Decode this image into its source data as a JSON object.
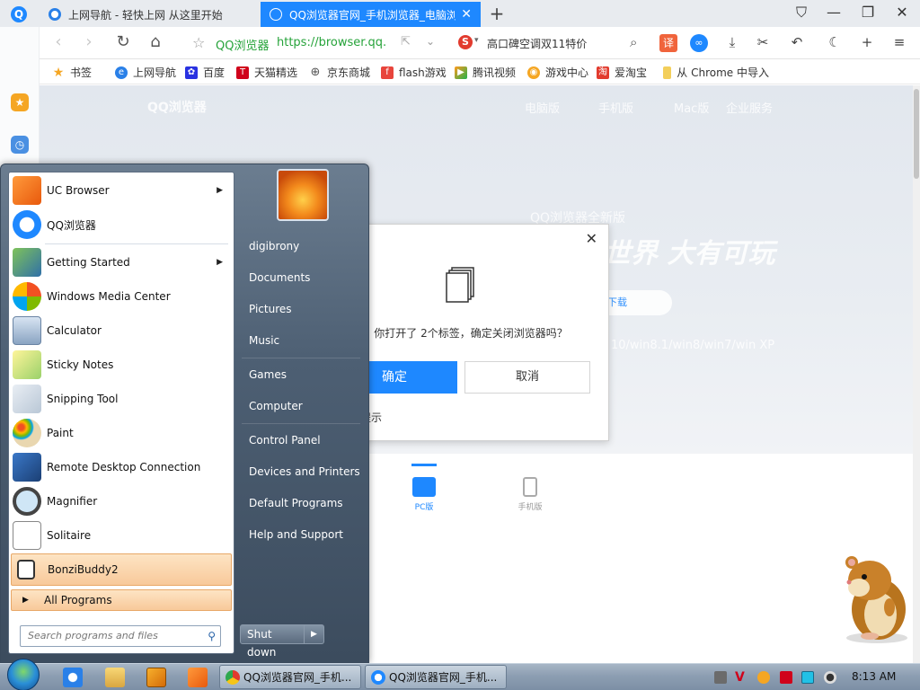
{
  "browser": {
    "tabs": [
      {
        "title": "上网导航 - 轻快上网 从这里开始",
        "active": false
      },
      {
        "title": "QQ浏览器官网_手机浏览器_电脑浏览",
        "active": true
      }
    ],
    "address": {
      "site_name": "QQ浏览器",
      "url": "https://browser.qq.",
      "search_engine_icon": "sogou-s-icon",
      "search_text": "高口碑空调双11特价"
    },
    "bookmarks": [
      {
        "label": "书签",
        "icon": "star-icon"
      },
      {
        "label": "上网导航",
        "icon": "ie-icon"
      },
      {
        "label": "百度",
        "icon": "baidu-icon"
      },
      {
        "label": "天猫精选",
        "icon": "tmall-icon"
      },
      {
        "label": "京东商城",
        "icon": "globe-icon"
      },
      {
        "label": "flash游戏",
        "icon": "flash-icon"
      },
      {
        "label": "腾讯视频",
        "icon": "tencent-video-icon"
      },
      {
        "label": "游戏中心",
        "icon": "game-center-icon"
      },
      {
        "label": "爱淘宝",
        "icon": "taobao-icon"
      },
      {
        "label": "从 Chrome 中导入",
        "icon": "folder-icon"
      }
    ],
    "colors": {
      "accent": "#1e88ff",
      "url_green": "#26a33a"
    }
  },
  "page": {
    "brand": "QQ浏览器",
    "nav": [
      "电脑版",
      "手机版",
      "Mac版",
      "企业服务"
    ],
    "hero_sub": "QQ浏览器全新版",
    "hero_big": "世界 大有可玩",
    "download_label": "下载",
    "os_text": "10/win8.1/win8/win7/win XP",
    "platforms": [
      {
        "label": "PC版",
        "active": true
      },
      {
        "label": "手机版",
        "active": false
      }
    ]
  },
  "dialog": {
    "message": "你打开了 2个标签，确定关闭浏览器吗？",
    "ok_label": "确定",
    "cancel_label": "取消",
    "checkbox_label": "再提示"
  },
  "start_menu": {
    "programs": [
      {
        "label": "UC Browser",
        "icon": "uc-browser-icon",
        "submenu": true
      },
      {
        "label": "QQ浏览器",
        "icon": "qq-browser-icon",
        "submenu": false
      },
      {
        "label": "Getting Started",
        "icon": "getting-started-icon",
        "submenu": true
      },
      {
        "label": "Windows Media Center",
        "icon": "media-center-icon",
        "submenu": false
      },
      {
        "label": "Calculator",
        "icon": "calculator-icon",
        "submenu": false
      },
      {
        "label": "Sticky Notes",
        "icon": "sticky-notes-icon",
        "submenu": false
      },
      {
        "label": "Snipping Tool",
        "icon": "snipping-tool-icon",
        "submenu": false
      },
      {
        "label": "Paint",
        "icon": "paint-icon",
        "submenu": false
      },
      {
        "label": "Remote Desktop Connection",
        "icon": "remote-desktop-icon",
        "submenu": false
      },
      {
        "label": "Magnifier",
        "icon": "magnifier-icon",
        "submenu": false
      },
      {
        "label": "Solitaire",
        "icon": "solitaire-icon",
        "submenu": false
      },
      {
        "label": "BonziBuddy2",
        "icon": "bonzibuddy-icon",
        "submenu": false,
        "highlighted": true
      }
    ],
    "all_programs_label": "All Programs",
    "search_placeholder": "Search programs and files",
    "right_items": [
      "digibrony",
      "Documents",
      "Pictures",
      "Music",
      "Games",
      "Computer",
      "Control Panel",
      "Devices and Printers",
      "Default Programs",
      "Help and Support"
    ],
    "shutdown_label": "Shut down"
  },
  "taskbar": {
    "tasks": [
      "QQ浏览器官网_手机...",
      "QQ浏览器官网_手机..."
    ],
    "clock": "8:13 AM"
  }
}
